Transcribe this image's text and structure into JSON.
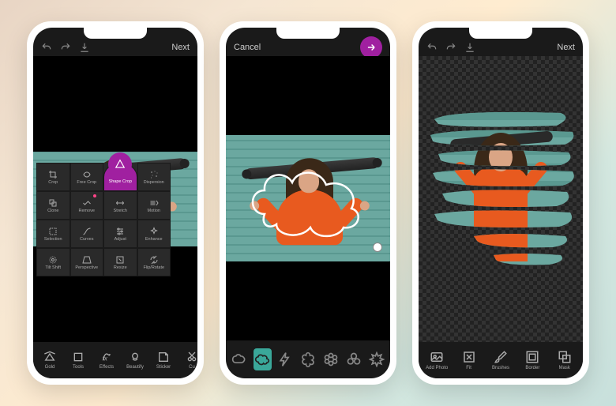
{
  "phone1": {
    "topbar": {
      "next": "Next"
    },
    "tools": [
      {
        "id": "crop",
        "label": "Crop"
      },
      {
        "id": "freecrop",
        "label": "Free Crop"
      },
      {
        "id": "shapecrop",
        "label": "Shape Crop",
        "selected": true
      },
      {
        "id": "dispersion",
        "label": "Dispersion"
      },
      {
        "id": "clone",
        "label": "Clone"
      },
      {
        "id": "remove",
        "label": "Remove",
        "badge": true
      },
      {
        "id": "stretch",
        "label": "Stretch"
      },
      {
        "id": "motion",
        "label": "Motion"
      },
      {
        "id": "selection",
        "label": "Selection"
      },
      {
        "id": "curves",
        "label": "Curves"
      },
      {
        "id": "adjust",
        "label": "Adjust"
      },
      {
        "id": "enhance",
        "label": "Enhance"
      },
      {
        "id": "tiltshift",
        "label": "Tilt Shift"
      },
      {
        "id": "perspective",
        "label": "Perspective"
      },
      {
        "id": "resize",
        "label": "Resize"
      },
      {
        "id": "fliprotate",
        "label": "Flip/Rotate"
      }
    ],
    "bottom": [
      {
        "id": "gold",
        "label": "Gold"
      },
      {
        "id": "tools",
        "label": "Tools"
      },
      {
        "id": "effects",
        "label": "Effects"
      },
      {
        "id": "beautify",
        "label": "Beautify"
      },
      {
        "id": "sticker",
        "label": "Sticker"
      },
      {
        "id": "cutout",
        "label": "Cu"
      }
    ]
  },
  "phone2": {
    "topbar": {
      "cancel": "Cancel"
    },
    "shapes": [
      {
        "id": "cloud-outline"
      },
      {
        "id": "cloud-filled",
        "selected": true
      },
      {
        "id": "lightning"
      },
      {
        "id": "flower-5"
      },
      {
        "id": "flower-6"
      },
      {
        "id": "clover"
      },
      {
        "id": "burst"
      }
    ]
  },
  "phone3": {
    "topbar": {
      "next": "Next"
    },
    "bottom": [
      {
        "id": "addphoto",
        "label": "Add Photo"
      },
      {
        "id": "fit",
        "label": "Fit"
      },
      {
        "id": "brushes",
        "label": "Brushes"
      },
      {
        "id": "border",
        "label": "Border"
      },
      {
        "id": "mask",
        "label": "Mask"
      }
    ]
  }
}
